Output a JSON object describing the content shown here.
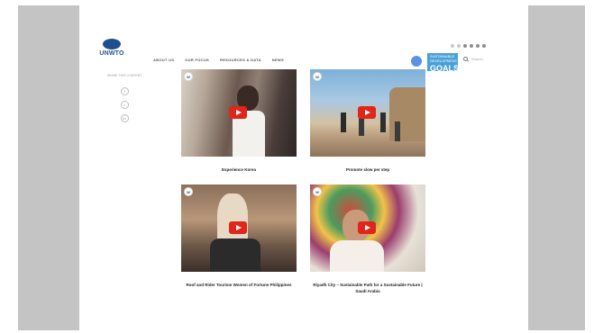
{
  "header": {
    "logo_text": "UNWTO",
    "site_title_line1": "",
    "site_title_line2": "",
    "nav": [
      "ABOUT US",
      "OUR FOCUS",
      "RESOURCES & DATA",
      "NEWS"
    ],
    "language": "",
    "sdg_top": "SUSTAINABLE DEVELOPMENT",
    "sdg_goals": "GOALS",
    "search_placeholder": "Search"
  },
  "share": {
    "label": "SHARE THIS CONTENT"
  },
  "videos": [
    {
      "caption": "Experience Korea",
      "video_title": "",
      "channel_mark": "W"
    },
    {
      "caption": "Promote slow per step",
      "video_title": "",
      "channel_mark": "W"
    },
    {
      "caption": "Roof and Rider Tourism Women of Fortune Philippines",
      "video_title": "",
      "channel_mark": "W"
    },
    {
      "caption": "Riyadh City – Sustainable Path for a Sustainable Future | Saudi Arabia",
      "video_title": "",
      "channel_mark": "W"
    }
  ],
  "colors": {
    "brand_blue": "#1f4f8f",
    "sdg_blue": "#4aa1d8",
    "youtube_red": "#e1251b",
    "backdrop": "#c4c4c4"
  },
  "icons": [
    "facebook-icon",
    "twitter-icon",
    "linkedin-icon",
    "search-icon",
    "play-icon"
  ]
}
